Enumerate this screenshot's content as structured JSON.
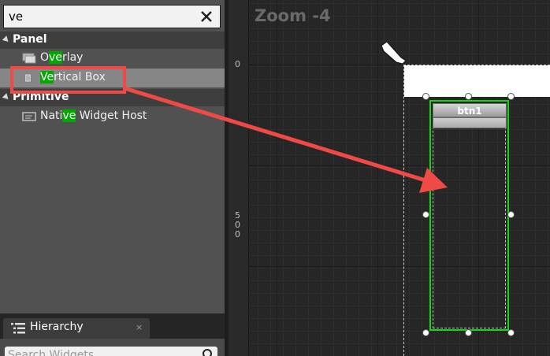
{
  "palette": {
    "search_value": "ve",
    "categories": [
      {
        "label": "Panel",
        "items": [
          {
            "prefix": "O",
            "match": "ve",
            "suffix": "rlay",
            "icon": "overlay-icon"
          },
          {
            "prefix": "",
            "match": "Ve",
            "suffix": "rtical Box",
            "icon": "vertical-box-icon"
          }
        ]
      },
      {
        "label": "Primitive",
        "items": [
          {
            "prefix": "Nati",
            "match": "ve",
            "suffix": " Widget Host",
            "icon": "native-widget-host-icon"
          }
        ]
      }
    ],
    "highlight_color": "#00a800",
    "annotation_color": "#f04a46"
  },
  "hierarchy": {
    "tab_label": "Hierarchy",
    "close_symbol": "×",
    "search_placeholder": "Search Widgets"
  },
  "designer": {
    "zoom_label": "Zoom -4",
    "ruler_top_zero": "0",
    "ruler_left_label": "5\n0\n0",
    "button_text": "btn1",
    "selection_color": "#16d516"
  }
}
